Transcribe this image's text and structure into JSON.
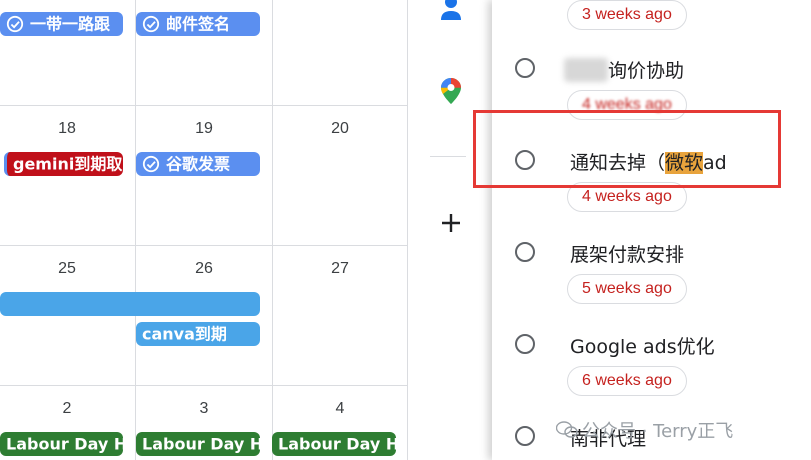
{
  "calendar": {
    "days": {
      "d18": "18",
      "d19": "19",
      "d20": "20",
      "d25": "25",
      "d26": "26",
      "d27": "27",
      "d2": "2",
      "d3": "3",
      "d4": "4"
    },
    "events": {
      "belt_road": "一带一路跟",
      "email_signature": "邮件签名",
      "gemini_expiry": "gemini到期取",
      "google_invoice": "谷歌发票",
      "canva_expiry": "canva到期",
      "labour_day_1": "Labour Day Ho",
      "labour_day_2": "Labour Day Ho",
      "labour_day_3": "Labour Day Ho"
    },
    "colors": {
      "task_blue": "#5b8ff0",
      "gemini_red": "#c0101a",
      "wide_bar_blue": "#4aa5e8",
      "holiday_green": "#2e7d32"
    }
  },
  "side_icons": {
    "contacts": "contacts-icon",
    "maps": "google-maps-icon",
    "add": "plus-icon"
  },
  "tasks": {
    "items": [
      {
        "title": "",
        "due": "3 weeks ago"
      },
      {
        "title": "询价协助",
        "due": "4 weeks ago"
      },
      {
        "title_prefix": "通知去掉（",
        "title_highlight": "微软",
        "title_suffix": "ad",
        "due": "4 weeks ago"
      },
      {
        "title": "展架付款安排",
        "due": "5 weeks ago"
      },
      {
        "title": "Google ads优化",
        "due": "6 weeks ago"
      },
      {
        "title": "南非代理",
        "due": ""
      }
    ],
    "due_color": "#c5221f",
    "highlight_color": "#e8a33c",
    "annotation_box_color": "#e53935"
  },
  "watermark": {
    "text": "公众号 · Terry正飞"
  }
}
